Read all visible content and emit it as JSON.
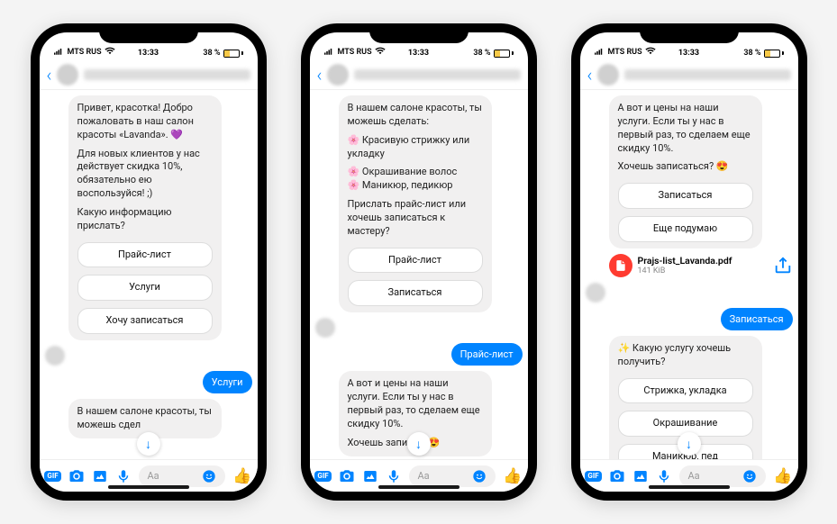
{
  "status": {
    "carrier": "MTS RUS",
    "time": "13:33",
    "battery_text": "38 %"
  },
  "input": {
    "placeholder": "Aa"
  },
  "phone1": {
    "msg1_p1": "Привет, красотка! Добро пожаловать в наш салон красоты «Lavanda». 💜",
    "msg1_p2": "Для новых клиентов у нас действует скидка 10%, обязательно ею воспользуйся! ;)",
    "msg1_p3": "Какую информацию прислать?",
    "btn1": "Прайс-лист",
    "btn2": "Услуги",
    "btn3": "Хочу записаться",
    "reply1": "Услуги",
    "msg2_p1": "В нашем салоне красоты, ты можешь сдел"
  },
  "phone2": {
    "msg1_p1": "В нашем салоне красоты, ты можешь сделать:",
    "msg1_l1": "🌸 Красивую стрижку или укладку",
    "msg1_l2": "🌸 Окрашивание волос",
    "msg1_l3": "🌸 Маникюр, педикюр",
    "msg1_p2": "Прислать прайс-лист или хочешь записаться к мастеру?",
    "btn1": "Прайс-лист",
    "btn2": "Записаться",
    "reply1": "Прайс-лист",
    "msg2_p1": "А вот и цены на наши услуги. Если ты у нас в первый раз, то сделаем еще скидку 10%.",
    "msg2_p2": "Хочешь запи      ся? 😍"
  },
  "phone3": {
    "msg1_p1": "А вот и цены на наши услуги. Если ты у нас в первый раз, то сделаем еще скидку 10%.",
    "msg1_p2": "Хочешь записаться? 😍",
    "btn1": "Записаться",
    "btn2": "Еще подумаю",
    "file_name": "Prajs-list_Lavanda.pdf",
    "file_size": "141 KiB",
    "reply1": "Записаться",
    "msg2_p1": "✨ Какую услугу хочешь получить?",
    "btn3": "Стрижка, укладка",
    "btn4": "Окрашивание",
    "btn5": "Маникюр, пед"
  }
}
